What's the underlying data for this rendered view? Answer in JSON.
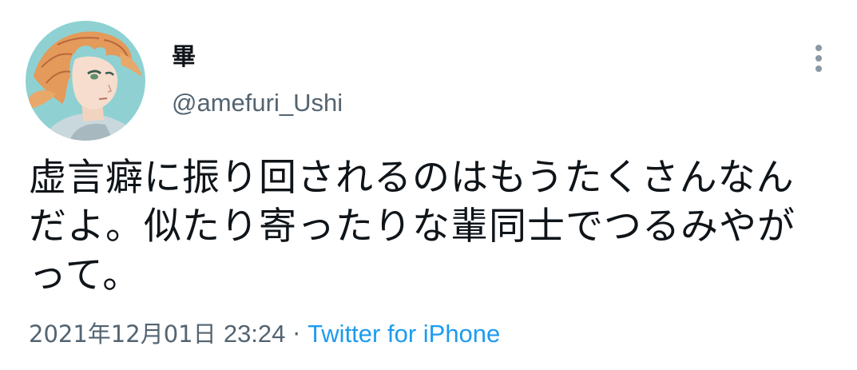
{
  "user": {
    "display_name": "畢",
    "handle": "@amefuri_Ushi",
    "avatar": "anime-character-avatar"
  },
  "tweet": {
    "text_lines": [
      "虚言癖に振り回されるのはもうたくさんなん",
      "だよ。似たり寄ったりな輩同士でつるみやが",
      "って。"
    ],
    "date": "2021年12月01日",
    "time": "23:24",
    "separator": "·",
    "source": "Twitter for iPhone"
  },
  "icons": {
    "more": "vertical-ellipsis-icon"
  },
  "colors": {
    "text_primary": "#0f1419",
    "text_secondary": "#536471",
    "link": "#1d9bf0",
    "avatar_bg": "#7fc9cc",
    "hair": "#e39a5a"
  }
}
